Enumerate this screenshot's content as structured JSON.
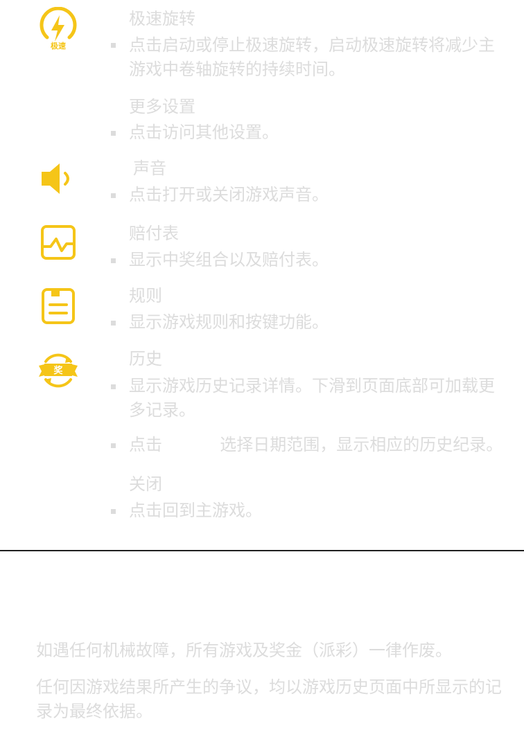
{
  "colors": {
    "accent": "#F5C518",
    "text": "#DCDCDC",
    "divider": "#1F1F1F"
  },
  "sections": [
    {
      "icon": "turbo-spin-icon",
      "icon_label": "极速",
      "title": "极速旋转",
      "desc": "点击启动或停止极速旋转，启动极速旋转将减少主游戏中卷轴旋转的持续时间。"
    },
    {
      "icon": "",
      "title": "更多设置",
      "desc": "点击访问其他设置。"
    },
    {
      "icon": "speaker-icon",
      "title": "声音",
      "desc": "点击打开或关闭游戏声音。"
    },
    {
      "icon": "chart-icon",
      "title": "赔付表",
      "desc": "显示中奖组合以及赔付表。"
    },
    {
      "icon": "rules-document-icon",
      "title": "规则",
      "desc": "显示游戏规则和按键功能。"
    },
    {
      "icon": "history-prize-icon",
      "icon_label": "奖",
      "title": "历史",
      "desc": "显示游戏历史记录详情。下滑到页面底部可加载更多记录。",
      "desc2_prefix": "点击",
      "desc2_suffix": "选择日期范围，显示相应的历史纪录。"
    },
    {
      "icon": "",
      "title": "关闭",
      "desc": "点击回到主游戏。"
    }
  ],
  "notices": [
    "如遇任何机械故障，所有游戏及奖金（派彩）一律作废。",
    "任何因游戏结果所产生的争议，均以游戏历史页面中所显示的记录为最终依据。"
  ]
}
